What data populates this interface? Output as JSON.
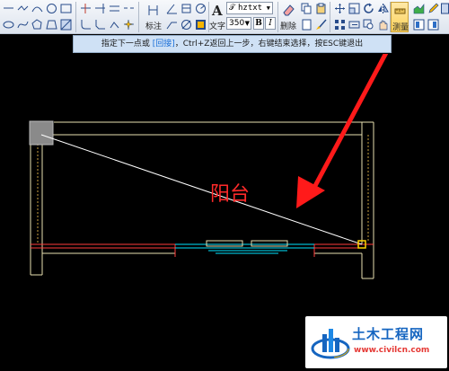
{
  "toolbar": {
    "dimension_label": "标注",
    "text_label": "文字",
    "font_name": "hztxt",
    "font_size": "350",
    "bold_label": "B",
    "italic_label": "I",
    "delete_label": "删除",
    "measure_label": "测量"
  },
  "prompt": {
    "text_before": "指定下一点或 ",
    "highlight": "[回接]",
    "text_after": "，Ctrl+Z返回上一步，右键结束选择，按ESC键退出"
  },
  "drawing": {
    "room_label": "阳台",
    "line_colors": {
      "wall": "#e8e0b0",
      "accent": "#ff3b3b",
      "measure_line": "#ffffff",
      "window": "#00e5ff",
      "arrow": "#ff1a1a",
      "endpoint_marker": "#ffd400"
    }
  },
  "watermark": {
    "title": "土木工程网",
    "url": "www.civilcn.com"
  }
}
